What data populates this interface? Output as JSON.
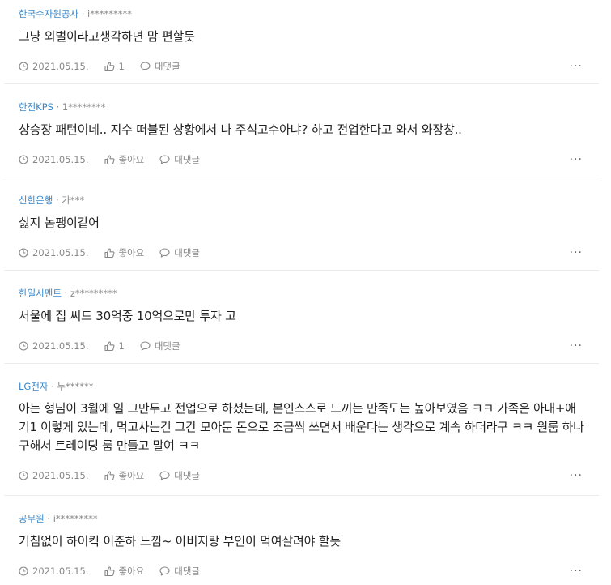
{
  "labels": {
    "like": "좋아요",
    "reply": "대댓글",
    "more": "···"
  },
  "comments": [
    {
      "company": "한국수자원공사",
      "user": "i*********",
      "text": "그냥 외벌이라고생각하면 맘 편할듯",
      "date": "2021.05.15.",
      "likes": "1"
    },
    {
      "company": "한전KPS",
      "user": "1********",
      "text": "상승장 패턴이네.. 지수 떠블된 상황에서 나 주식고수아냐? 하고 전업한다고 와서 와장창..",
      "date": "2021.05.15.",
      "likes": "좋아요"
    },
    {
      "company": "신한은행",
      "user": "가***",
      "text": "싫지 놈팽이같어",
      "date": "2021.05.15.",
      "likes": "좋아요"
    },
    {
      "company": "한일시멘트",
      "user": "z*********",
      "text": "서울에 집 씨드 30억중 10억으로만 투자 고",
      "date": "2021.05.15.",
      "likes": "1"
    },
    {
      "company": "LG전자",
      "user": "누******",
      "text": "아는 형님이 3월에 일 그만두고 전업으로 하셨는데, 본인스스로 느끼는 만족도는 높아보였음 ㅋㅋ 가족은 아내+애기1 이렇게 있는데, 먹고사는건 그간 모아둔 돈으로 조금씩 쓰면서 배운다는 생각으로 계속 하더라구 ㅋㅋ 원룸 하나 구해서 트레이딩 룸 만들고 말여 ㅋㅋ",
      "date": "2021.05.15.",
      "likes": "좋아요"
    },
    {
      "company": "공무원",
      "user": "i*********",
      "text": "거침없이 하이킥 이준하 느낌~ 아버지랑 부인이 먹여살려야 할듯",
      "date": "2021.05.15.",
      "likes": "좋아요"
    }
  ]
}
